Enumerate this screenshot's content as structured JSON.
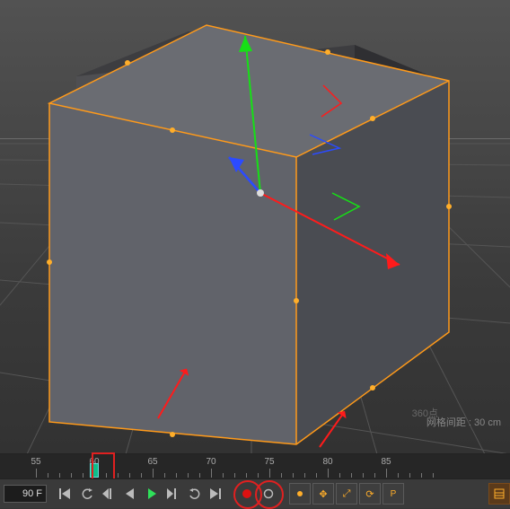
{
  "viewport": {
    "grid_spacing_label": "网格间距 : 30 cm",
    "watermark": "360点"
  },
  "timeline": {
    "ticks": [
      "55",
      "60",
      "65",
      "70",
      "75",
      "80",
      "85"
    ],
    "keyframe_at": 60,
    "highlighted_frame": 60
  },
  "transport": {
    "current_frame": "90 F",
    "buttons": [
      {
        "name": "go-to-start",
        "icon": "start"
      },
      {
        "name": "undo",
        "icon": "undo"
      },
      {
        "name": "step-back",
        "icon": "stepback"
      },
      {
        "name": "play-back",
        "icon": "playback"
      },
      {
        "name": "play-forward",
        "icon": "play"
      },
      {
        "name": "step-forward",
        "icon": "stepfwd"
      },
      {
        "name": "redo",
        "icon": "redo"
      },
      {
        "name": "go-to-end",
        "icon": "end"
      }
    ],
    "record_buttons": [
      {
        "name": "record-keyframe",
        "label": "●"
      },
      {
        "name": "auto-key",
        "label": "○"
      }
    ],
    "gizmo_buttons": [
      {
        "name": "move-key",
        "label": "✥"
      },
      {
        "name": "scale-key",
        "label": "⇲"
      },
      {
        "name": "rotate-key",
        "label": "⟳"
      },
      {
        "name": "param-key",
        "label": "P"
      }
    ]
  }
}
